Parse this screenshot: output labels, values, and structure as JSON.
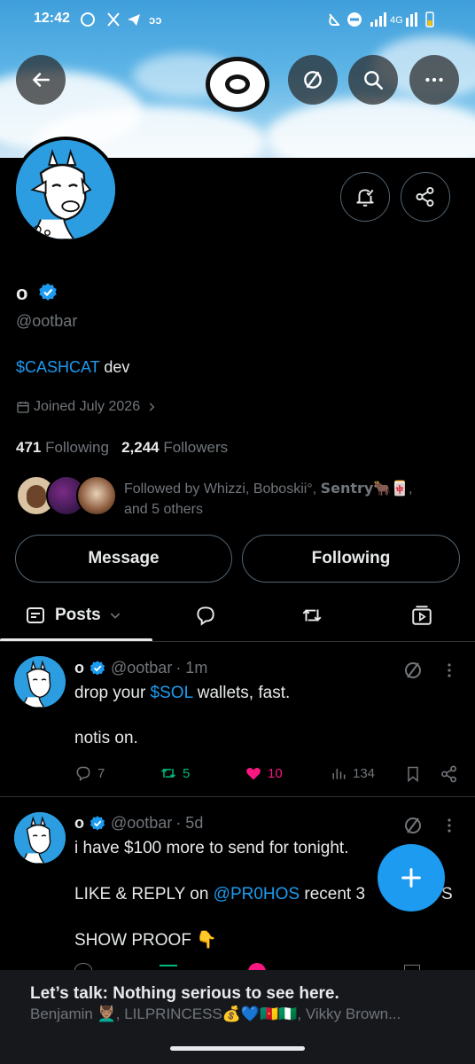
{
  "status_bar": {
    "time": "12:42",
    "left_icons": [
      "whatsapp-icon",
      "x-icon",
      "telegram-icon",
      "app-icon",
      "dot-icon"
    ],
    "right_icons": [
      "mute-icon",
      "dnd-icon",
      "signal-icon",
      "network-4g",
      "battery-icon"
    ],
    "network_label": "4G"
  },
  "header": {
    "back_icon": "arrow-left-icon",
    "no_sign_icon": "circle-slash-icon",
    "search_icon": "search-icon",
    "more_icon": "more-icon"
  },
  "profile": {
    "display_name": "o",
    "handle": "@ootbar",
    "bio_link": "$CASHCAT",
    "bio_rest": " dev",
    "joined": "Joined July 2026",
    "following_count": "471",
    "following_label": "Following",
    "followers_count": "2,244",
    "followers_label": "Followers",
    "followed_by_line1": "Followed by Whizzi, Boboskii°, 𝗦𝗲𝗻𝘁𝗿𝘆🐂🀄,",
    "followed_by_line2": "and 5 others",
    "message_button": "Message",
    "following_button": "Following"
  },
  "tabs": {
    "posts_label": "Posts",
    "icons": [
      "replies-icon",
      "reposts-icon",
      "media-icon"
    ]
  },
  "posts": [
    {
      "name": "o",
      "handle": "@ootbar",
      "time": "· 1m",
      "line1_pre": "drop your ",
      "line1_link": "$SOL",
      "line1_post": " wallets, fast.",
      "line2": "notis on.",
      "replies": "7",
      "reposts": "5",
      "likes": "10",
      "views": "134"
    },
    {
      "name": "o",
      "handle": "@ootbar",
      "time": "· 5d",
      "line1": "i have $100 more to send for tonight.",
      "line2_pre": "LIKE & REPLY on ",
      "line2_link": "@PR0HOS",
      "line2_post": " recent 3",
      "line2_tail": "S",
      "line3": "SHOW PROOF 👇"
    }
  ],
  "fab_icon": "plus-icon",
  "bottom_bar": {
    "title": "Let’s talk: Nothing serious to see here.",
    "subtitle": "Benjamin 💆🏽‍♂️, LILPRINCESS💰💙🇨🇲🇳🇬, Vikky Brown..."
  },
  "colors": {
    "accent": "#1d9bf0",
    "repost_green": "#00ba7c",
    "like_pink": "#f91880",
    "muted": "#71767b"
  }
}
